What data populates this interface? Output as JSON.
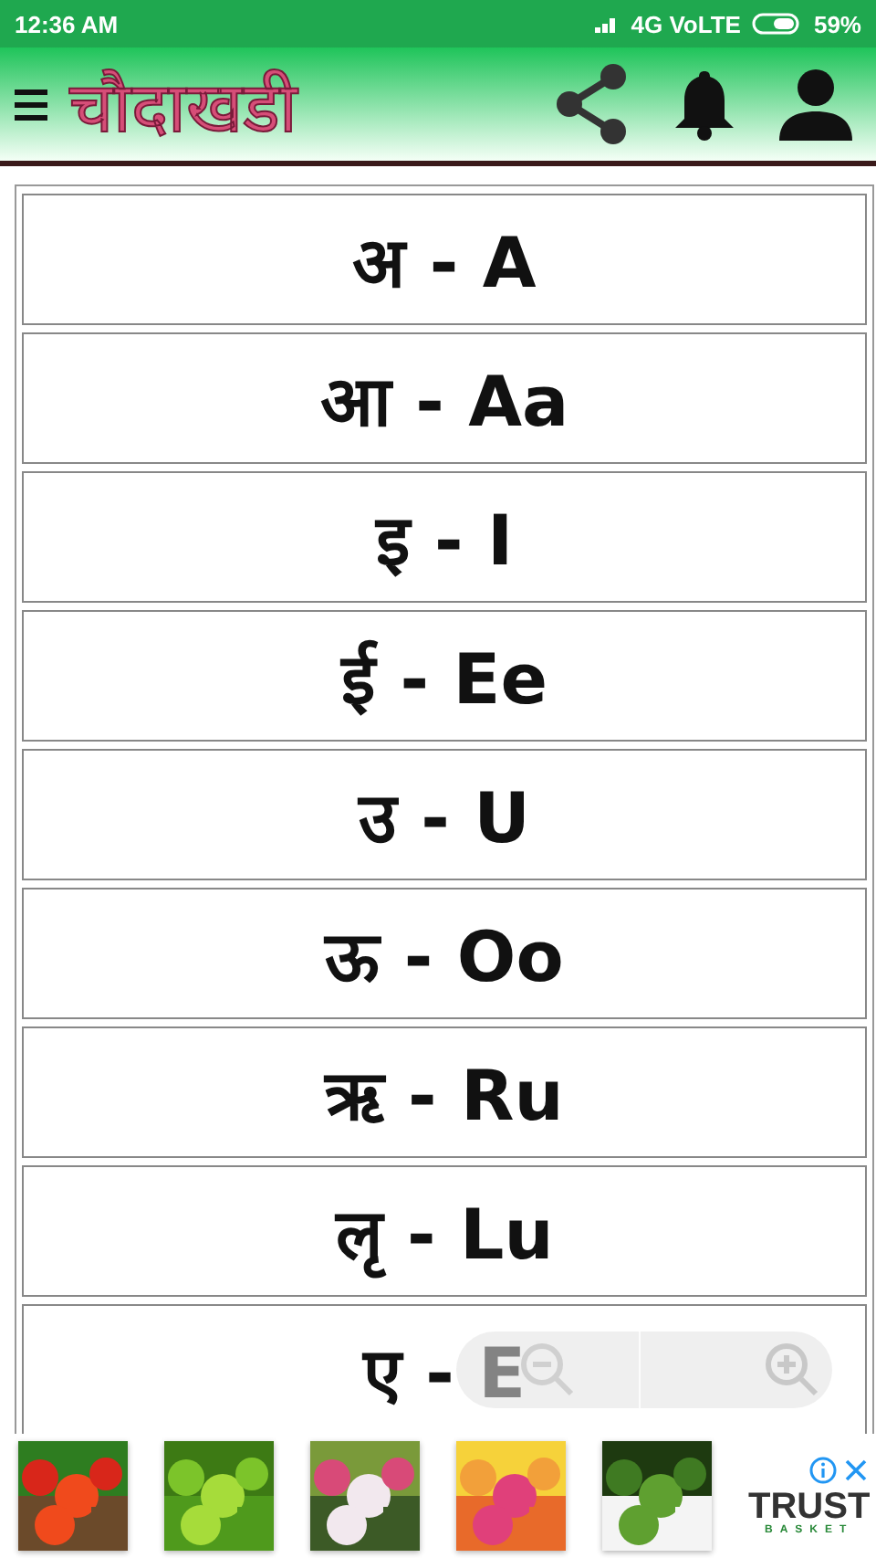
{
  "status_bar": {
    "time": "12:36 AM",
    "network": "4G VoLTE",
    "battery": "59%"
  },
  "app_bar": {
    "title": "चौदाखडी"
  },
  "letters": [
    {
      "label": "अ - A"
    },
    {
      "label": "आ - Aa"
    },
    {
      "label": "इ - I"
    },
    {
      "label": "ई - Ee"
    },
    {
      "label": "उ - U"
    },
    {
      "label": "ऊ - Oo"
    },
    {
      "label": "ऋ - Ru"
    },
    {
      "label": "लृ - Lu"
    },
    {
      "label": "ए - E"
    }
  ],
  "ad": {
    "brand": "TRUST",
    "brand_sub": "BASKET"
  }
}
